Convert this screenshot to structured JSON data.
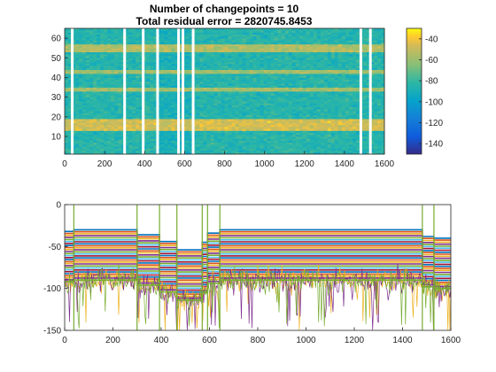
{
  "title_lines": [
    "Number of changepoints = 10",
    "Total residual error = 2820745.8453"
  ],
  "chart_data": [
    {
      "type": "heatmap",
      "title": "Number of changepoints = 10 / Total residual error = 2820745.8453",
      "xlim": [
        0,
        1600
      ],
      "ylim": [
        1,
        65
      ],
      "x_ticks": [
        0,
        200,
        400,
        600,
        800,
        1000,
        1200,
        1400,
        1600
      ],
      "y_ticks": [
        10,
        20,
        30,
        40,
        50,
        60
      ],
      "changepoints": [
        38,
        300,
        393,
        465,
        570,
        592,
        643,
        1482,
        1530
      ],
      "colorbar": {
        "range": [
          -150,
          -30
        ],
        "ticks": [
          -40,
          -60,
          -80,
          -100,
          -120,
          -140
        ],
        "colormap": "parula"
      },
      "row_bands": [
        {
          "rows": [
            53,
            57
          ],
          "level": -55
        },
        {
          "rows": [
            42,
            44
          ],
          "level": -58
        },
        {
          "rows": [
            33,
            35
          ],
          "level": -58
        },
        {
          "rows": [
            13,
            19
          ],
          "level": -47
        }
      ],
      "background_level": -85
    },
    {
      "type": "line",
      "xlim": [
        0,
        1600
      ],
      "ylim": [
        -150,
        0
      ],
      "x_ticks": [
        0,
        200,
        400,
        600,
        800,
        1000,
        1200,
        1400,
        1600
      ],
      "y_ticks": [
        0,
        -50,
        -100,
        -150
      ],
      "changepoints": [
        38,
        300,
        393,
        465,
        570,
        592,
        643,
        1482,
        1530
      ],
      "changepoint_color": "#77AC30",
      "segment_means_top_series": [
        -32,
        -30,
        -36,
        -44,
        -54,
        -45,
        -34,
        -30,
        -38,
        -40
      ],
      "series_colors": [
        "#0072BD",
        "#D95319",
        "#EDB120",
        "#7E2F8E",
        "#77AC30",
        "#4DBEEE",
        "#A2142F"
      ]
    }
  ]
}
